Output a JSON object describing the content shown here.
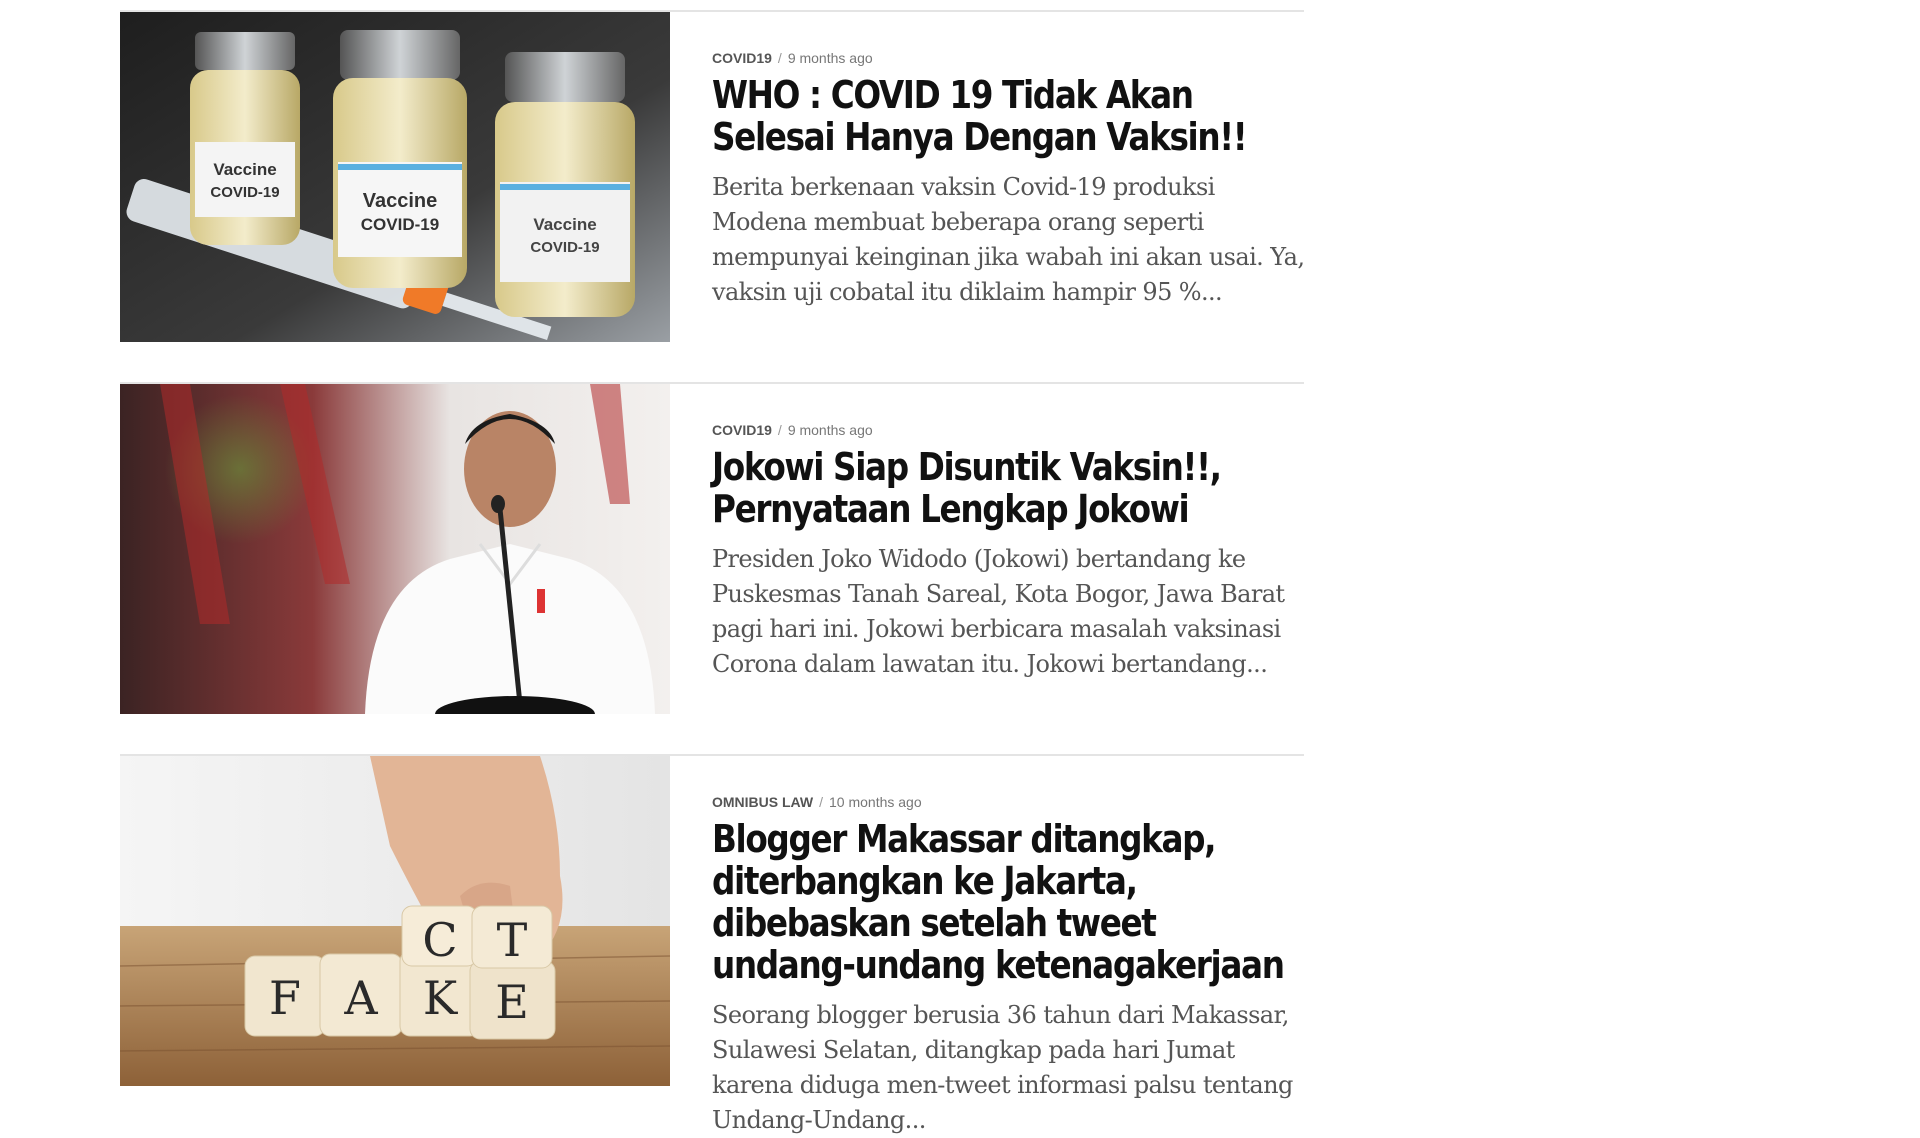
{
  "articles": [
    {
      "category": "COVID19",
      "time": "9 months ago",
      "title": "WHO : COVID 19 Tidak Akan Selesai Hanya Dengan Vaksin!!",
      "excerpt": "Berita berkenaan vaksin Covid-19 produksi Modena membuat beberapa orang seperti mempunyai keinginan jika wabah ini akan usai. Ya, vaksin uji cobatal itu diklaim hampir 95 %...",
      "image": {
        "vial_label_1": "Vaccine",
        "vial_label_2": "COVID-19"
      }
    },
    {
      "category": "COVID19",
      "time": "9 months ago",
      "title": "Jokowi Siap Disuntik Vaksin!!, Pernyataan Lengkap Jokowi",
      "excerpt": "Presiden Joko Widodo (Jokowi) bertandang ke Puskesmas Tanah Sareal, Kota Bogor, Jawa Barat pagi hari ini. Jokowi berbicara masalah vaksinasi Corona dalam lawatan itu. Jokowi bertandang..."
    },
    {
      "category": "OMNIBUS LAW",
      "time": "10 months ago",
      "title": "Blogger Makassar ditangkap, diterbangkan ke Jakarta, dibebaskan setelah tweet undang-undang ketenagakerjaan",
      "excerpt": "Seorang blogger berusia 36 tahun dari Makassar, Sulawesi Selatan, ditangkap pada hari Jumat karena diduga men-tweet informasi palsu tentang Undang-Undang...",
      "image": {
        "cube_letters": [
          "F",
          "A",
          "K",
          "E",
          "C",
          "T"
        ]
      }
    }
  ],
  "separator": "/"
}
